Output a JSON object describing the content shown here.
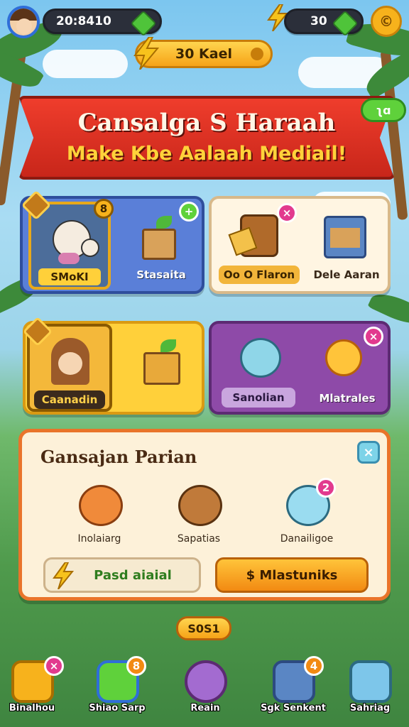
{
  "topbar": {
    "player_score": "20:8410",
    "energy_count": "30",
    "coin_symbol": "©"
  },
  "reward_pill": {
    "label": "30 Kael"
  },
  "banner": {
    "title": "Cansalga S Haraah",
    "subtitle": "Make Kbe Aalaah Mediail!",
    "tag": "ʅɑ"
  },
  "cards": {
    "card1": {
      "tile_label": "SMoKI",
      "badge": "8",
      "item_label": "Stasaita"
    },
    "card2": {
      "tile_label": "Oo O Flaron",
      "badge": "×",
      "item_label": "Dele Aaran"
    },
    "card3": {
      "tile_label": "Caanadin",
      "badge": ""
    },
    "card4": {
      "tile_label": "Sanolian",
      "badge": "×",
      "item_label": "Mlatrales"
    }
  },
  "panel": {
    "title": "Gansajan Parian",
    "close_label": "×",
    "pets": [
      {
        "label": "Inolaiarg"
      },
      {
        "label": "Sapatias"
      },
      {
        "label": "Danailigoe",
        "badge": "2"
      }
    ],
    "left_button": "Pasd aiaial",
    "right_button": "$  Mlastuniks"
  },
  "pager": {
    "label": "S0S1"
  },
  "nav": [
    {
      "label": "Binalhou",
      "badge": "×"
    },
    {
      "label": "Shiao Sarp",
      "badge": "8"
    },
    {
      "label": "Reain",
      "badge": ""
    },
    {
      "label": "Sgk Senkent",
      "badge": "4"
    },
    {
      "label": "Sahriag",
      "badge": ""
    }
  ],
  "colors": {
    "accent_red": "#ef3d2c",
    "accent_gold": "#f6a317",
    "accent_green": "#5fd13b",
    "panel_border": "#e9742a"
  }
}
